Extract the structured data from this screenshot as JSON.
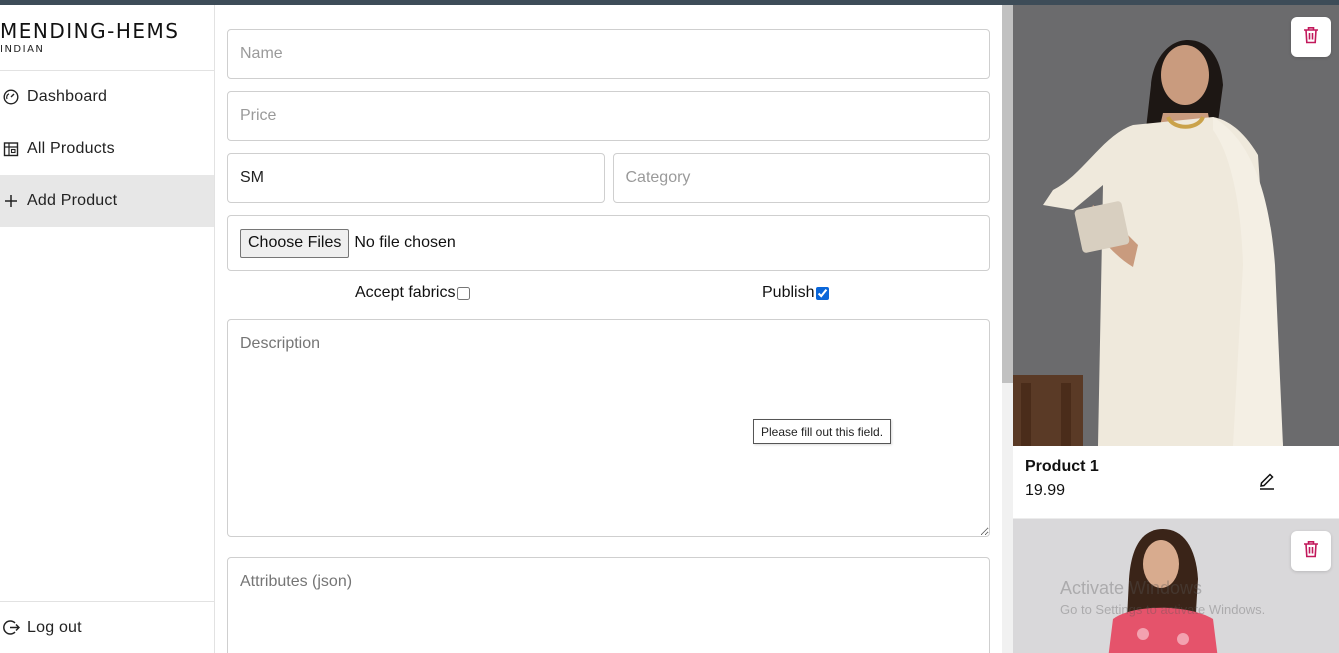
{
  "brand": {
    "name": "MENDING-HEMS",
    "sub": "INDIAN"
  },
  "sidebar": {
    "items": [
      {
        "label": "Dashboard",
        "icon": "gauge-icon"
      },
      {
        "label": "All Products",
        "icon": "box-icon"
      },
      {
        "label": "Add Product",
        "icon": "plus-icon",
        "active": true
      }
    ],
    "logout_label": "Log out"
  },
  "form": {
    "name_placeholder": "Name",
    "price_placeholder": "Price",
    "size_value": "SM",
    "category_placeholder": "Category",
    "file_button": "Choose Files",
    "file_status": "No file chosen",
    "accept_fabrics_label": "Accept fabrics",
    "accept_fabrics_checked": false,
    "publish_label": "Publish",
    "publish_checked": true,
    "description_placeholder": "Description",
    "attributes_placeholder": "Attributes (json)",
    "validation_tooltip": "Please fill out this field."
  },
  "products": [
    {
      "name": "Product 1",
      "price": "19.99"
    },
    {
      "name": "",
      "price": ""
    }
  ],
  "watermark": {
    "line1": "Activate Windows",
    "line2": "Go to Settings to activate Windows."
  },
  "colors": {
    "accent": "#c2185b",
    "checkbox": "#0a66d9",
    "topbar": "#3d4c58"
  }
}
